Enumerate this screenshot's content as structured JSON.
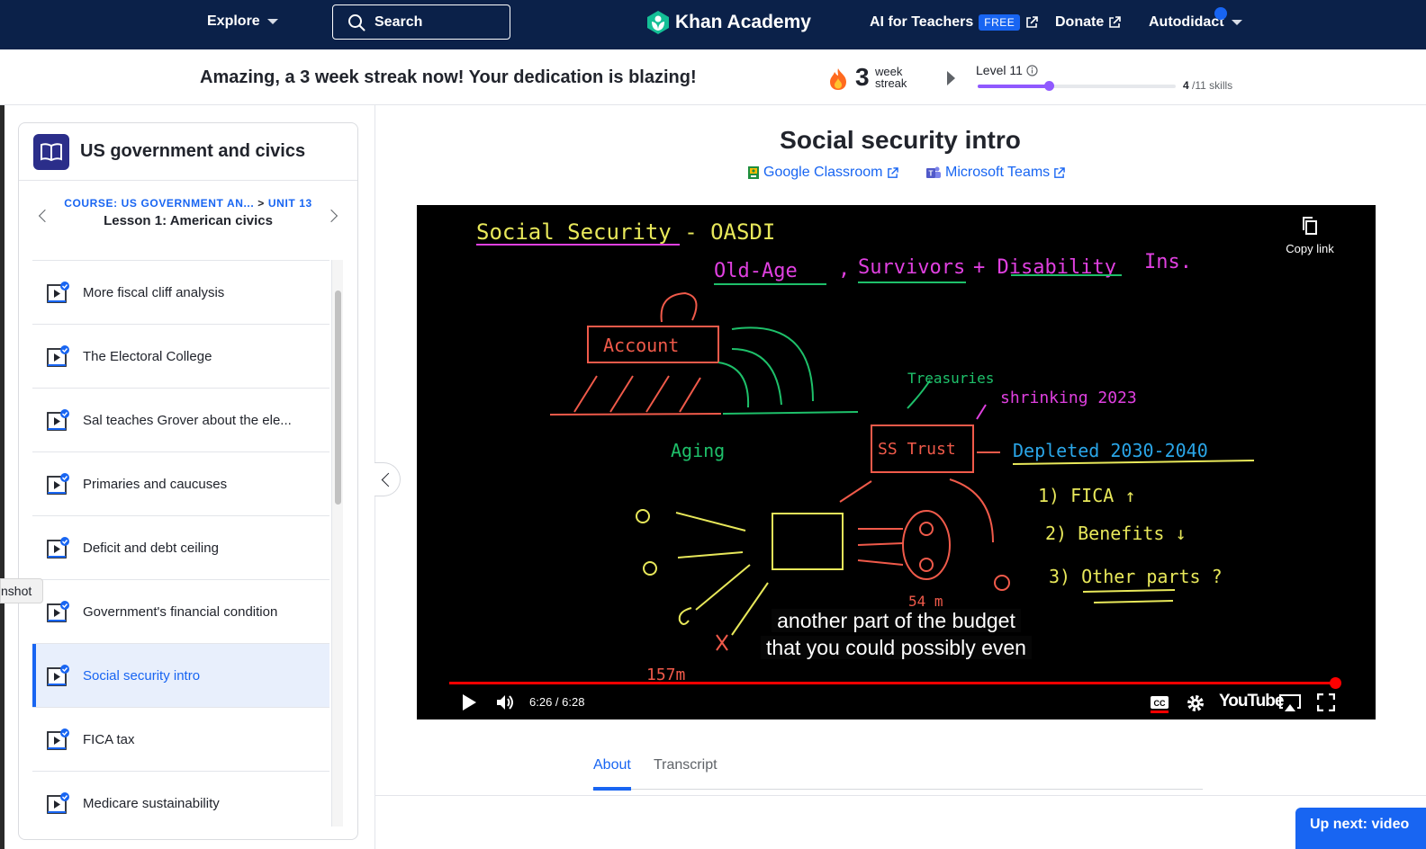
{
  "nav": {
    "explore": "Explore",
    "search_placeholder": "Search",
    "brand": "Khan Academy",
    "ai_teachers": "AI for Teachers",
    "free_badge": "FREE",
    "donate": "Donate",
    "user": "Autodidact"
  },
  "streak": {
    "message": "Amazing, a 3 week streak now! Your dedication is blazing!",
    "count": "3",
    "unit_line1": "week",
    "unit_line2": "streak",
    "level_label": "Level 11",
    "skills_done": "4",
    "skills_total": "/11 skills",
    "level_progress": 0.36
  },
  "sidebar": {
    "course_title": "US government and civics",
    "crumb_course": "COURSE: US GOVERNMENT AN...",
    "crumb_sep": ">",
    "crumb_unit": "UNIT 13",
    "lesson_title": "Lesson 1: American civics",
    "items": [
      {
        "label": "More fiscal cliff analysis"
      },
      {
        "label": "The Electoral College"
      },
      {
        "label": "Sal teaches Grover about the ele..."
      },
      {
        "label": "Primaries and caucuses"
      },
      {
        "label": "Deficit and debt ceiling"
      },
      {
        "label": "Government's financial condition"
      },
      {
        "label": "Social security intro"
      },
      {
        "label": "FICA tax"
      },
      {
        "label": "Medicare sustainability"
      }
    ],
    "active_index": 6
  },
  "tooltip": "nshot",
  "main": {
    "title": "Social security intro",
    "share_google": "Google Classroom",
    "share_teams": "Microsoft Teams",
    "tabs": [
      "About",
      "Transcript"
    ],
    "up_next": "Up next: video"
  },
  "video": {
    "copy_link": "Copy link",
    "caption_line1": "another part of the budget",
    "caption_line2": "that you could possibly even",
    "time": "6:26 / 6:28",
    "youtube": "YouTube",
    "progress": 0.995,
    "board": {
      "title": "Social Security - OASDI",
      "subtitle_a": "Old-Age",
      "subtitle_b": "Survivors",
      "subtitle_c": "+ Disability",
      "subtitle_d": "Ins.",
      "account": "Account",
      "treasuries": "Treasuries",
      "shrinking": "shrinking 2023",
      "aging": "Aging",
      "ss_trust": "SS Trust",
      "depleted": "Depleted 2030-2040",
      "fix1": "1) FICA ↑",
      "fix2": "2) Benefits ↓",
      "fix3": "3) Other parts ?",
      "fifty_four": "54 m",
      "one_fifty_seven": "157m"
    }
  },
  "colors": {
    "nav_bg": "#0b2149",
    "accent": "#1865f2",
    "level": "#9059ff",
    "board_yellow": "#e8e85a",
    "board_magenta": "#e040e0",
    "board_green": "#1ec06a",
    "board_red": "#f05a4a",
    "board_cyan": "#2aa6e8"
  }
}
